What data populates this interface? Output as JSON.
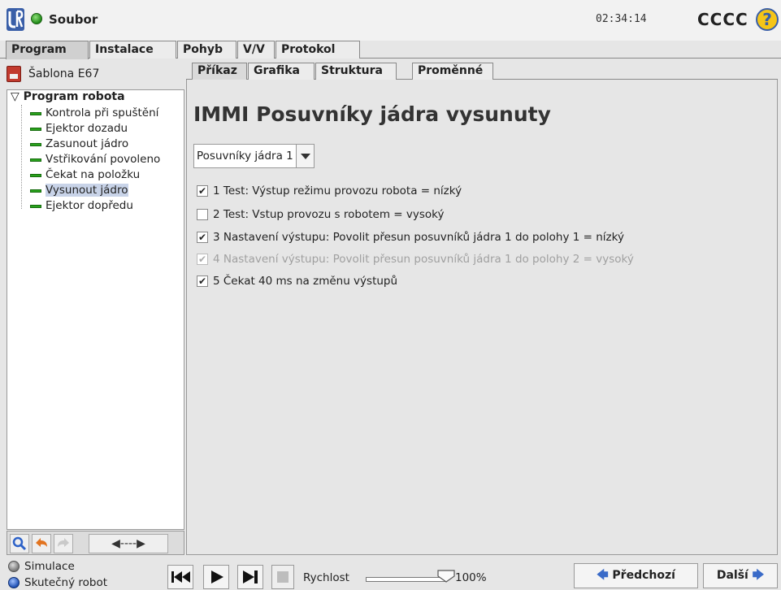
{
  "topbar": {
    "file_label": "Soubor",
    "clock": "02:34:14",
    "robot_name": "CCCC",
    "help_symbol": "?"
  },
  "main_tabs": [
    {
      "label": "Program",
      "active": true
    },
    {
      "label": "Instalace",
      "active": false
    },
    {
      "label": "Pohyb",
      "active": false
    },
    {
      "label": "V/V",
      "active": false
    },
    {
      "label": "Protokol",
      "active": false
    }
  ],
  "left": {
    "template_label": "Šablona E67",
    "tree_root": "Program robota",
    "tree_root_toggle": "▽",
    "tree_items": [
      {
        "label": "Kontrola při spuštění",
        "selected": false
      },
      {
        "label": "Ejektor dozadu",
        "selected": false
      },
      {
        "label": "Zasunout jádro",
        "selected": false
      },
      {
        "label": "Vstřikování povoleno",
        "selected": false
      },
      {
        "label": "Čekat na položku",
        "selected": false
      },
      {
        "label": "Vysunout jádro",
        "selected": true
      },
      {
        "label": "Ejektor dopředu",
        "selected": false
      }
    ],
    "toolbar": {
      "arrow_symbol": "◀----▶"
    }
  },
  "sub_tabs": [
    {
      "label": "Příkaz",
      "active": true
    },
    {
      "label": "Grafika",
      "active": false
    },
    {
      "label": "Struktura",
      "active": false
    },
    {
      "label": "Proměnné",
      "active": false
    }
  ],
  "content": {
    "title": "IMMI Posuvníky jádra vysunuty",
    "dropdown": {
      "value": "Posuvníky jádra 1"
    },
    "checks": [
      {
        "label": "1 Test: Výstup režimu provozu robota = nízký",
        "checked": true,
        "enabled": true
      },
      {
        "label": "2 Test: Vstup provozu s robotem = vysoký",
        "checked": false,
        "enabled": true
      },
      {
        "label": "3 Nastavení výstupu: Povolit přesun posuvníků jádra 1 do polohy 1 = nízký",
        "checked": true,
        "enabled": true
      },
      {
        "label": "4 Nastavení výstupu: Povolit přesun posuvníků jádra 1 do polohy 2 = vysoký",
        "checked": true,
        "enabled": false
      },
      {
        "label": "5 Čekat 40 ms na změnu výstupů",
        "checked": true,
        "enabled": true
      }
    ]
  },
  "bottom": {
    "mode_simulation": "Simulace",
    "mode_real": "Skutečný robot",
    "speed_label": "Rychlost",
    "speed_value": "100%",
    "speed_fraction": 1.0,
    "prev_label": "Předchozí",
    "next_label": "Další",
    "prev_arrow": "🡄",
    "next_arrow": "🡆"
  },
  "colors": {
    "leaf_green": "#2aa31d",
    "selection": "#c8d3e8",
    "template_red": "#c23a2e",
    "arrow_blue": "#3a6bc8"
  }
}
